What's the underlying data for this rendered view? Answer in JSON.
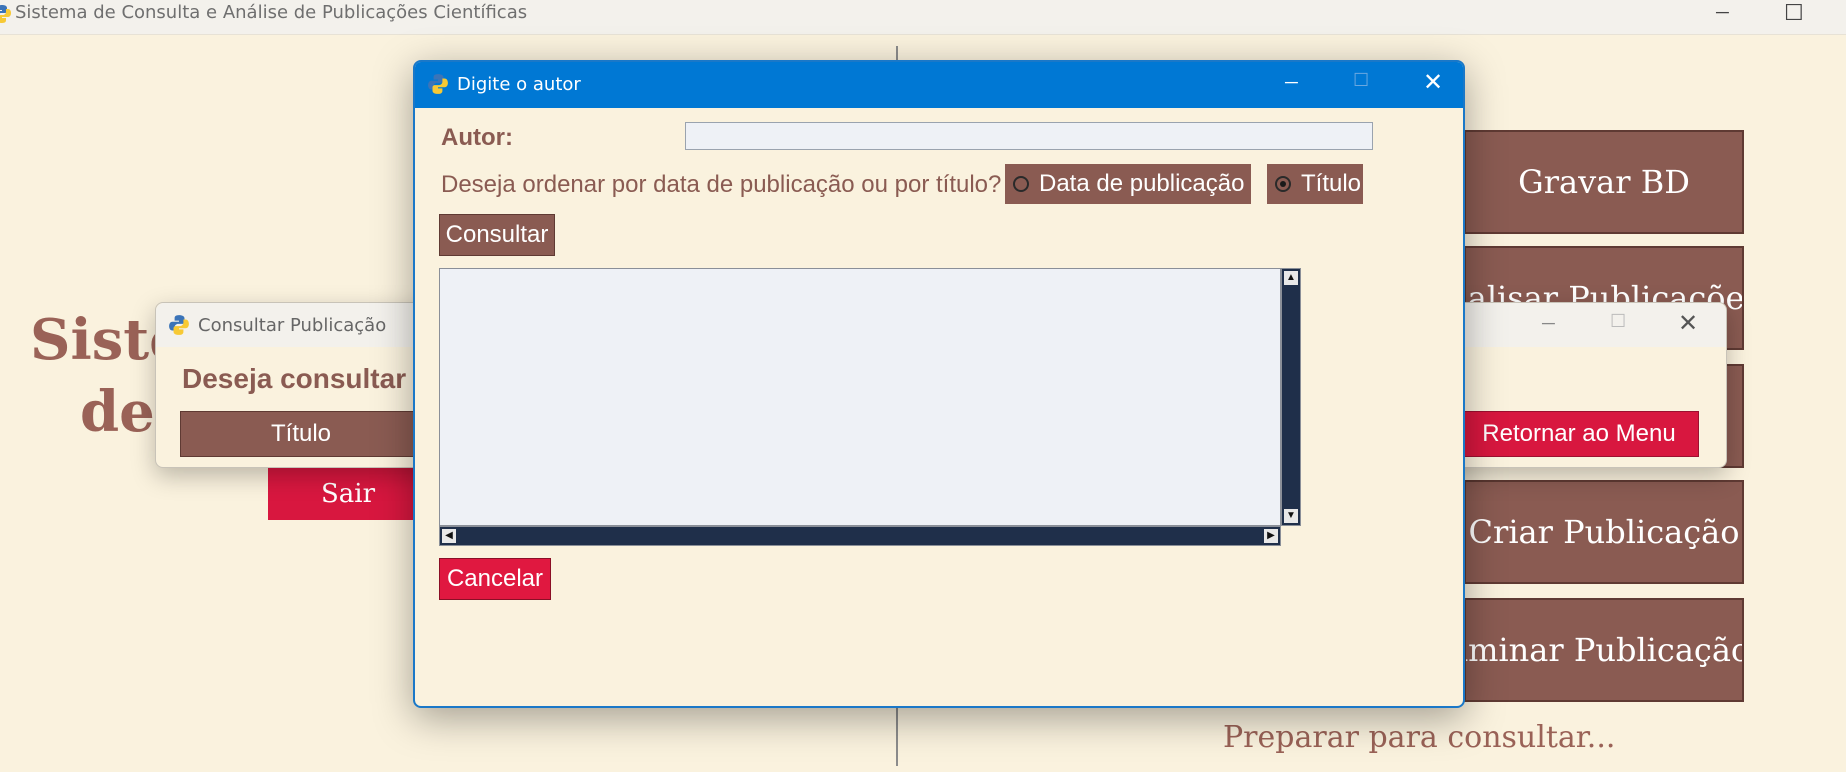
{
  "main_window": {
    "title": "Sistema de Consulta e Análise de Publicações Científicas",
    "heading_line1": "Siste",
    "heading_line2": "de",
    "menu_buttons": [
      "Gravar BD",
      "nalisar Publicações",
      "",
      "Criar Publicação",
      "iminar Publicação"
    ],
    "exit_label": "Sair",
    "status_text": "Preparar para consultar..."
  },
  "consultar_dialog": {
    "title": "Consultar Publicação",
    "question": "Deseja consultar",
    "titulo_label": "Título",
    "return_label": "Retornar ao Menu"
  },
  "autor_dialog": {
    "title": "Digite o autor",
    "author_label": "Autor:",
    "author_value": "",
    "order_question": "Deseja ordenar por data de publicação ou por título?",
    "radio_options": [
      "Data de publicação",
      "Título"
    ],
    "selected_option": "Título",
    "consultar_label": "Consultar",
    "cancel_label": "Cancelar"
  },
  "colors": {
    "background": "#faf2de",
    "accent_brown": "#8a5b52",
    "danger_red": "#d8173f",
    "titlebar_blue": "#0078d4",
    "scrollbar": "#1f2f4a"
  },
  "icons": [
    "python-icon",
    "minimize-icon",
    "maximize-icon",
    "close-icon"
  ]
}
